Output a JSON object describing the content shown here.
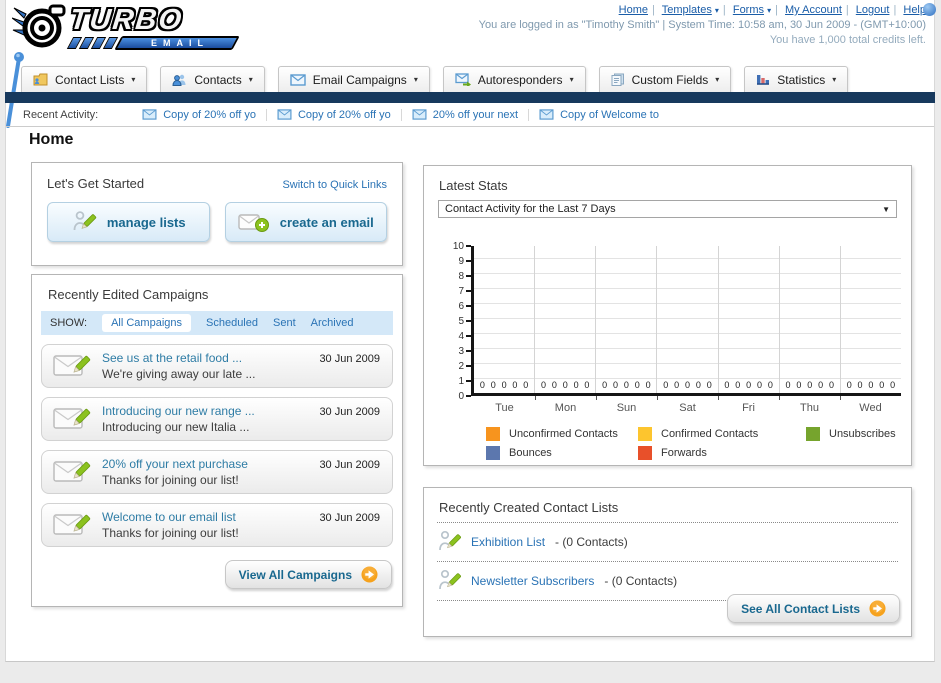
{
  "header": {
    "logo": {
      "title": "TURBO",
      "subtitle": "EMAIL"
    },
    "links": [
      "Home",
      "Templates",
      "Forms",
      "My Account",
      "Logout",
      "Help"
    ],
    "sep": "|",
    "caret": "▾",
    "status_line1": "You are logged in as \"Timothy Smith\" | System Time: 10:58 am, 30 Jun 2009 - (GMT+10:00)",
    "status_line2": "You have 1,000 total credits left."
  },
  "nav": {
    "caret": "▾",
    "items": [
      {
        "label": "Contact Lists"
      },
      {
        "label": "Contacts"
      },
      {
        "label": "Email Campaigns"
      },
      {
        "label": "Autoresponders"
      },
      {
        "label": "Custom Fields"
      },
      {
        "label": "Statistics"
      }
    ]
  },
  "recent_activity": {
    "label": "Recent Activity:",
    "items": [
      "Copy of 20% off yo",
      "Copy of 20% off yo",
      "20% off your next",
      "Copy of Welcome to"
    ]
  },
  "page_title": "Home",
  "get_started": {
    "title": "Let's Get Started",
    "switch_link": "Switch to Quick Links",
    "manage_lists_label": "manage lists",
    "create_email_label": "create an email"
  },
  "campaigns": {
    "title": "Recently Edited Campaigns",
    "show_label": "SHOW:",
    "tabs": [
      {
        "label": "All Campaigns",
        "active": true
      },
      {
        "label": "Scheduled",
        "active": false
      },
      {
        "label": "Sent",
        "active": false
      },
      {
        "label": "Archived",
        "active": false
      }
    ],
    "items": [
      {
        "title": "See us at the retail food ...",
        "subtitle": "We're giving away our late ...",
        "date": "30 Jun 2009"
      },
      {
        "title": "Introducing our new range ...",
        "subtitle": "Introducing our new Italia ...",
        "date": "30 Jun 2009"
      },
      {
        "title": "20% off your next purchase",
        "subtitle": "Thanks for joining our list!",
        "date": "30 Jun 2009"
      },
      {
        "title": "Welcome to our email list",
        "subtitle": "Thanks for joining our list!",
        "date": "30 Jun 2009"
      }
    ],
    "view_all_label": "View All Campaigns"
  },
  "latest_stats": {
    "title": "Latest Stats",
    "dropdown_value": "Contact Activity for the Last 7 Days",
    "dropdown_caret": "▼"
  },
  "chart_data": {
    "type": "bar",
    "title": "Contact Activity for the Last 7 Days",
    "categories": [
      "Tue",
      "Mon",
      "Sun",
      "Sat",
      "Fri",
      "Thu",
      "Wed"
    ],
    "series": [
      {
        "name": "Unconfirmed Contacts",
        "color": "#f7941e",
        "values": [
          0,
          0,
          0,
          0,
          0,
          0,
          0
        ]
      },
      {
        "name": "Confirmed Contacts",
        "color": "#fdc52e",
        "values": [
          0,
          0,
          0,
          0,
          0,
          0,
          0
        ]
      },
      {
        "name": "Unsubscribes",
        "color": "#76a42d",
        "values": [
          0,
          0,
          0,
          0,
          0,
          0,
          0
        ]
      },
      {
        "name": "Bounces",
        "color": "#5c77ae",
        "values": [
          0,
          0,
          0,
          0,
          0,
          0,
          0
        ]
      },
      {
        "name": "Forwards",
        "color": "#e8502a",
        "values": [
          0,
          0,
          0,
          0,
          0,
          0,
          0
        ]
      }
    ],
    "xlabel": "",
    "ylabel": "",
    "ylim": [
      0,
      10
    ],
    "ytick_step": 1,
    "grid": true,
    "legend_position": "bottom"
  },
  "contact_lists": {
    "title": "Recently Created Contact Lists",
    "items": [
      {
        "name": "Exhibition List",
        "suffix": "- (0 Contacts)"
      },
      {
        "name": "Newsletter Subscribers",
        "suffix": "- (0 Contacts)"
      }
    ],
    "see_all_label": "See All Contact Lists"
  }
}
